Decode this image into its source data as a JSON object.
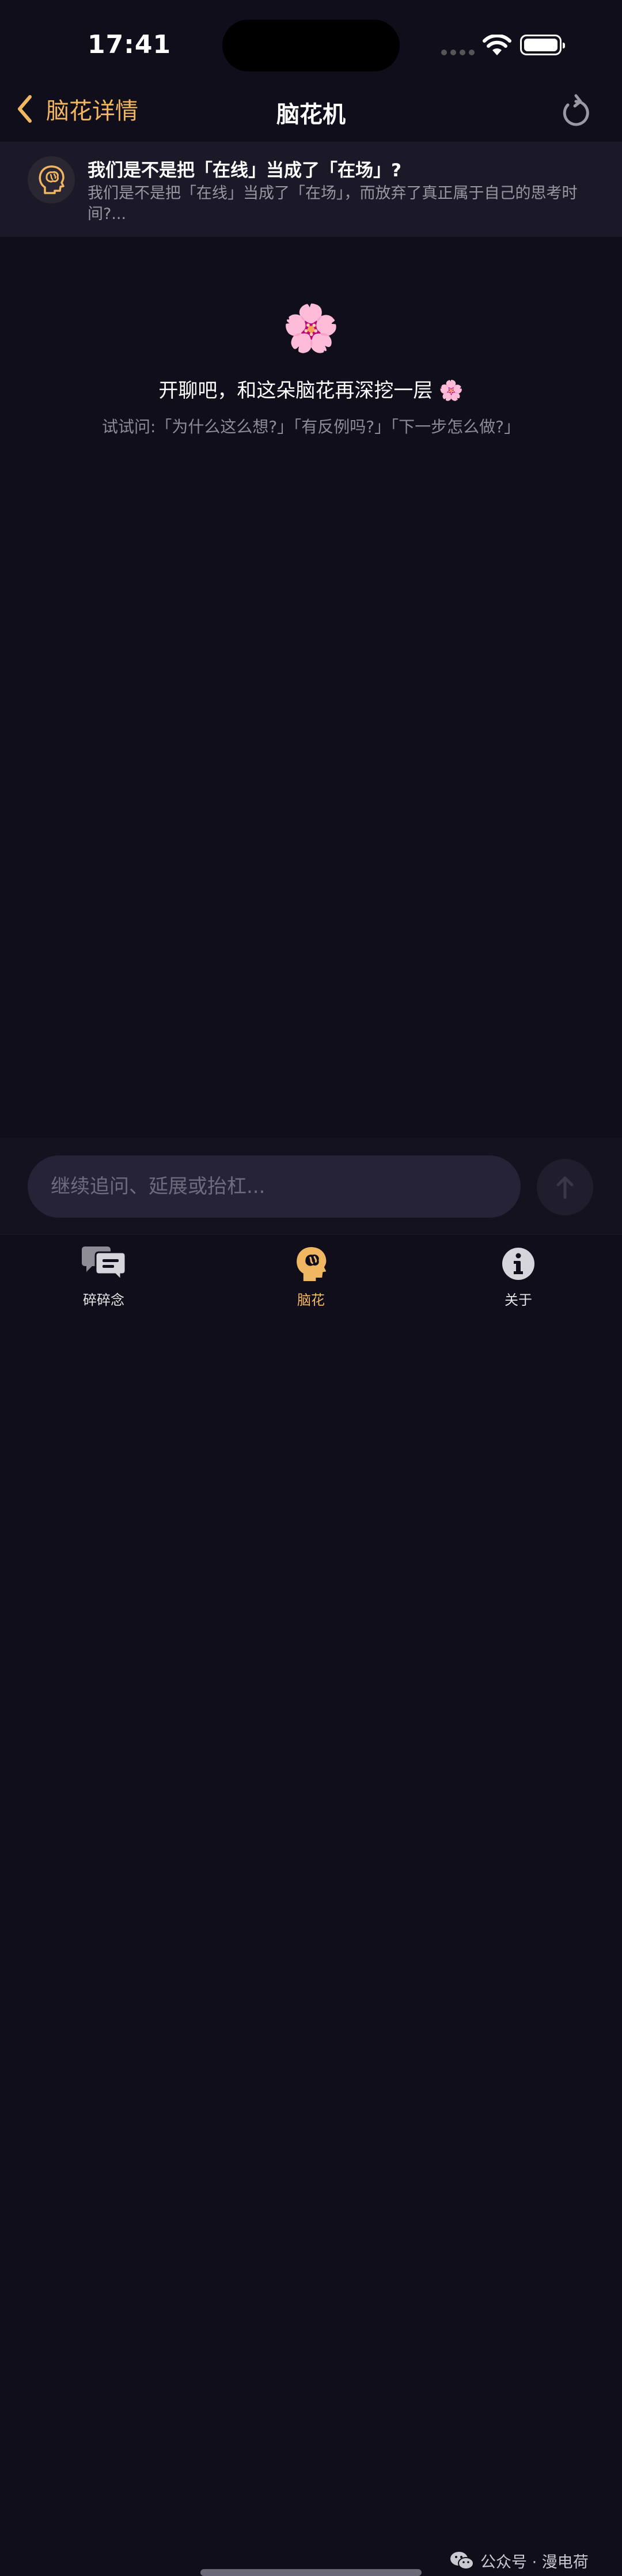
{
  "status_bar": {
    "time": "17:41"
  },
  "nav": {
    "back_label": "脑花详情",
    "title": "脑花机"
  },
  "topic": {
    "title": "我们是不是把「在线」当成了「在场」?",
    "body": "我们是不是把「在线」当成了「在场」，而放弃了真正属于自己的思考时间?..."
  },
  "empty_state": {
    "emoji": "🌸",
    "title": "开聊吧，和这朵脑花再深挖一层 🌸",
    "hint": "试试问:「为什么这么想?」「有反例吗?」「下一步怎么做?」"
  },
  "composer": {
    "placeholder": "继续追问、延展或抬杠..."
  },
  "tabs": [
    {
      "label": "碎碎念",
      "icon": "chat-bubbles-icon",
      "active": false
    },
    {
      "label": "脑花",
      "icon": "brain-head-icon",
      "active": true
    },
    {
      "label": "关于",
      "icon": "info-icon",
      "active": false
    }
  ],
  "watermark": {
    "text": "公众号 · 漫电荷"
  },
  "colors": {
    "accent": "#f1b661",
    "background": "#100e1b",
    "topic_bg": "#1b1928",
    "input_bg": "#262338"
  }
}
